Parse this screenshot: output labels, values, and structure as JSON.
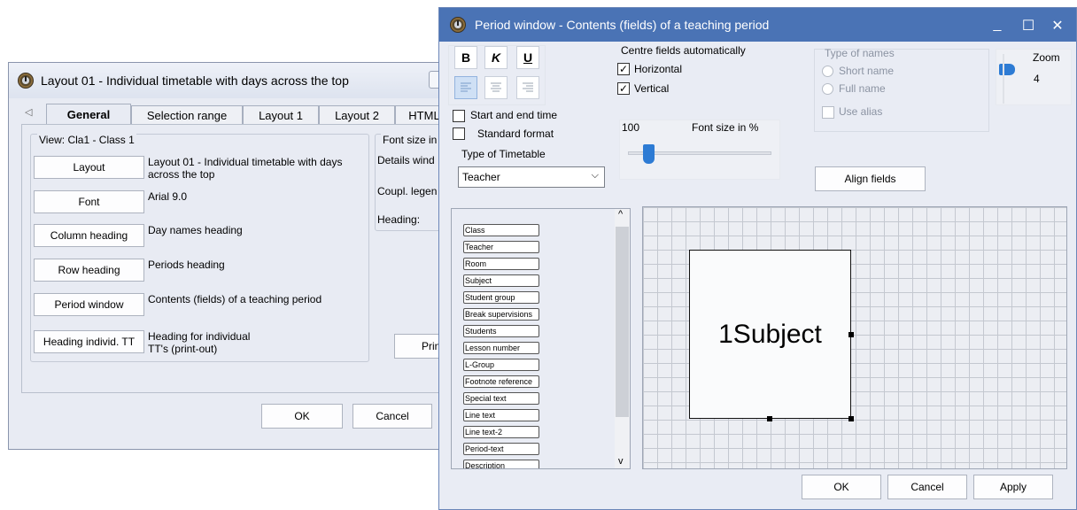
{
  "colors": {
    "title_active": "#4a73b5",
    "dialog_bg": "#e9ecf4",
    "grid_line": "#c4c8d0"
  },
  "icons": {
    "app": "clock-icon",
    "help": "help-icon",
    "minimize": "minimize-icon",
    "maximize": "maximize-icon",
    "close": "close-icon"
  },
  "layout_window": {
    "title": "Layout 01 - Individual timetable with days across the top",
    "tabs": [
      "General",
      "Selection range",
      "Layout 1",
      "Layout 2",
      "HTML"
    ],
    "tab_scroll_glyph": "◁",
    "view_group": "View: Cla1 - Class 1",
    "rows": [
      {
        "button": "Layout",
        "desc": "Layout 01 - Individual timetable with days across the top"
      },
      {
        "button": "Font",
        "desc": "Arial 9.0"
      },
      {
        "button": "Column heading",
        "desc": "Day names heading"
      },
      {
        "button": "Row heading",
        "desc": "Periods heading"
      },
      {
        "button": "Period window",
        "desc": "Contents (fields) of a teaching period"
      },
      {
        "button": "Heading individ. TT",
        "desc": "Heading for individual TT's (print-out)"
      }
    ],
    "font_size_group": "Font size in",
    "right_labels": [
      "Details wind",
      "Coupl. legen",
      "Heading:"
    ],
    "print_button": "Print",
    "ok": "OK",
    "cancel": "Cancel"
  },
  "period_window": {
    "title": "Period window - Contents (fields) of a teaching period",
    "controls": {
      "minimize": "_",
      "maximize": "☐",
      "close": "✕"
    },
    "format": {
      "bold": "B",
      "italic": "K",
      "underline": "U"
    },
    "center_fields": {
      "title": "Centre fields automatically",
      "horizontal": "Horizontal",
      "vertical": "Vertical",
      "horizontal_checked": true,
      "vertical_checked": true
    },
    "start_end_time": "Start and end time",
    "standard_format": "Standard format",
    "type_of_timetable": {
      "label": "Type of Timetable",
      "value": "Teacher"
    },
    "font_size": {
      "value_text": "100",
      "label": "Font size in %"
    },
    "type_of_names": {
      "title": "Type of names",
      "short": "Short name",
      "full": "Full name",
      "alias": "Use alias"
    },
    "zoom": {
      "label": "Zoom",
      "value": "4"
    },
    "align_fields": "Align fields",
    "fields": [
      "Class",
      "Teacher",
      "Room",
      "Subject",
      "Student group",
      "Break supervisions",
      "Students",
      "Lesson number",
      "L-Group",
      "Footnote reference",
      "Special text",
      "Line text",
      "Line text-2",
      "Period-text",
      "Description"
    ],
    "preview_text": "1Subject",
    "ok": "OK",
    "cancel": "Cancel",
    "apply": "Apply",
    "scroll_up": "^",
    "scroll_down": "v"
  }
}
